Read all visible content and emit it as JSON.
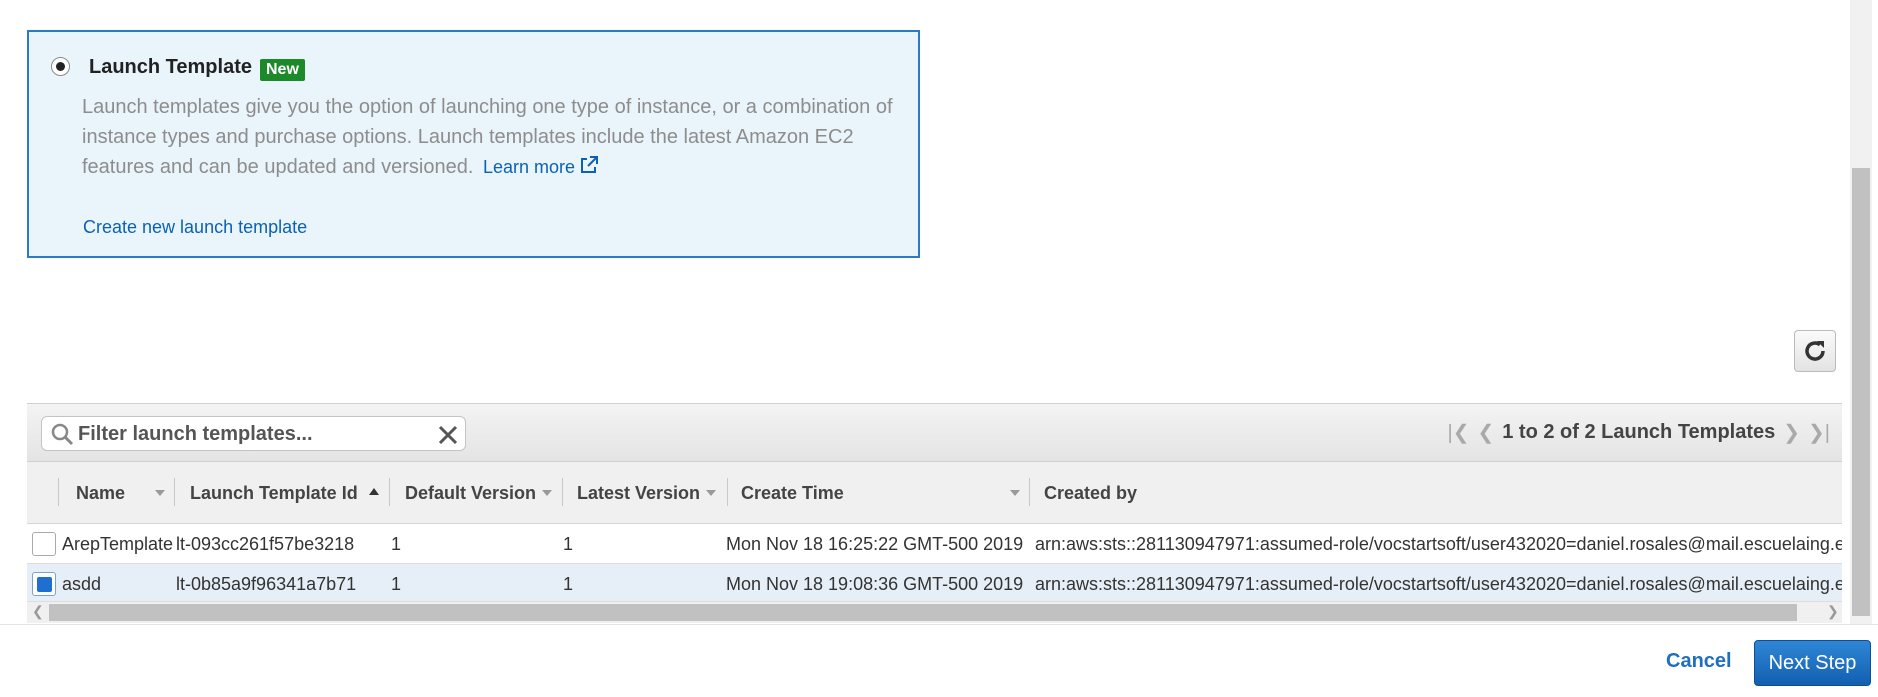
{
  "option": {
    "title": "Launch Template",
    "badge": "New",
    "description": "Launch templates give you the option of launching one type of instance, or a combination of instance types and purchase options. Launch templates include the latest Amazon EC2 features and can be updated and versioned.",
    "learn_more": "Learn more",
    "create_link": "Create new launch template",
    "selected": true
  },
  "filter": {
    "placeholder": "Filter launch templates..."
  },
  "pagination": {
    "summary": "1 to 2 of 2 Launch Templates"
  },
  "table": {
    "columns": [
      "Name",
      "Launch Template Id",
      "Default Version",
      "Latest Version",
      "Create Time",
      "Created by"
    ],
    "rows": [
      {
        "selected": false,
        "name": "ArepTemplate",
        "id": "lt-093cc261f57be3218",
        "default_version": "1",
        "latest_version": "1",
        "create_time": "Mon Nov 18 16:25:22 GMT-500 2019",
        "created_by": "arn:aws:sts::281130947971:assumed-role/vocstartsoft/user432020=daniel.rosales@mail.escuelaing.edu.co"
      },
      {
        "selected": true,
        "name": "asdd",
        "id": "lt-0b85a9f96341a7b71",
        "default_version": "1",
        "latest_version": "1",
        "create_time": "Mon Nov 18 19:08:36 GMT-500 2019",
        "created_by": "arn:aws:sts::281130947971:assumed-role/vocstartsoft/user432020=daniel.rosales@mail.escuelaing.edu.co"
      }
    ]
  },
  "footer": {
    "cancel": "Cancel",
    "next": "Next Step"
  },
  "colors": {
    "accent": "#2b7bc0",
    "badge_green": "#1d8a2a",
    "link": "#0b62b5",
    "primary_button": "#135fb0"
  }
}
